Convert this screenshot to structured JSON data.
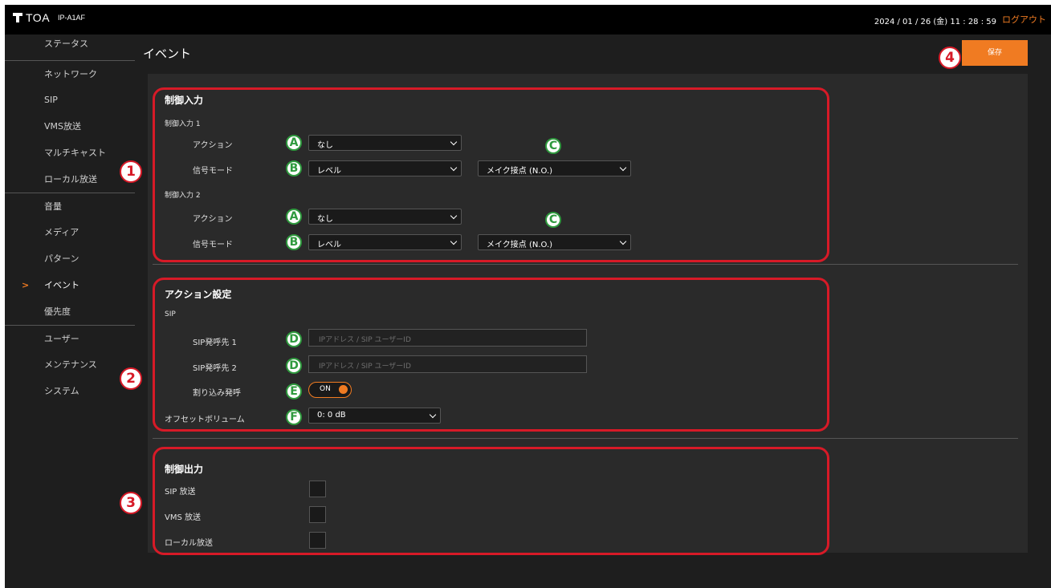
{
  "header": {
    "brand": "TOA",
    "model": "IP-A1AF",
    "datetime": "2024 / 01 / 26 (金)  11 : 28 : 59",
    "logout": "ログアウト"
  },
  "sidebar": {
    "items": [
      {
        "label": "ステータス"
      },
      {
        "label": "ネットワーク"
      },
      {
        "label": "SIP"
      },
      {
        "label": "VMS放送"
      },
      {
        "label": "マルチキャスト"
      },
      {
        "label": "ローカル放送"
      },
      {
        "label": "音量"
      },
      {
        "label": "メディア"
      },
      {
        "label": "パターン"
      },
      {
        "label": "イベント"
      },
      {
        "label": "優先度"
      },
      {
        "label": "ユーザー"
      },
      {
        "label": "メンテナンス"
      },
      {
        "label": "システム"
      }
    ],
    "active_index": 9
  },
  "page": {
    "title": "イベント",
    "save_label": "保存"
  },
  "control_input": {
    "title": "制御入力",
    "groups": [
      {
        "title": "制御入力 1",
        "action_label": "アクション",
        "action_value": "なし",
        "signal_label": "信号モード",
        "signal_value": "レベル",
        "contact_value": "メイク接点 (N.O.)"
      },
      {
        "title": "制御入力 2",
        "action_label": "アクション",
        "action_value": "なし",
        "signal_label": "信号モード",
        "signal_value": "レベル",
        "contact_value": "メイク接点 (N.O.)"
      }
    ]
  },
  "action_settings": {
    "title": "アクション設定",
    "sip_title": "SIP",
    "dest1_label": "SIP発呼先 1",
    "dest1_placeholder": "IPアドレス / SIP ユーザーID",
    "dest1_value": "",
    "dest2_label": "SIP発呼先 2",
    "dest2_placeholder": "IPアドレス / SIP ユーザーID",
    "dest2_value": "",
    "interrupt_label": "割り込み発呼",
    "interrupt_state": "ON",
    "offset_label": "オフセットボリューム",
    "offset_value": "0: 0 dB"
  },
  "control_output": {
    "title": "制御出力",
    "items": [
      {
        "label": "SIP 放送",
        "checked": false
      },
      {
        "label": "VMS 放送",
        "checked": false
      },
      {
        "label": "ローカル放送",
        "checked": false
      }
    ]
  },
  "callouts": {
    "numbers": [
      "1",
      "2",
      "3",
      "4"
    ],
    "letters": [
      "A",
      "B",
      "C",
      "D",
      "E",
      "F"
    ]
  },
  "colors": {
    "accent": "#f07b22",
    "callout_red": "#d71a27",
    "callout_green": "#2f9a3e",
    "background": "#1e1e1e",
    "panel": "#2a2a2a",
    "topbar": "#000000"
  }
}
